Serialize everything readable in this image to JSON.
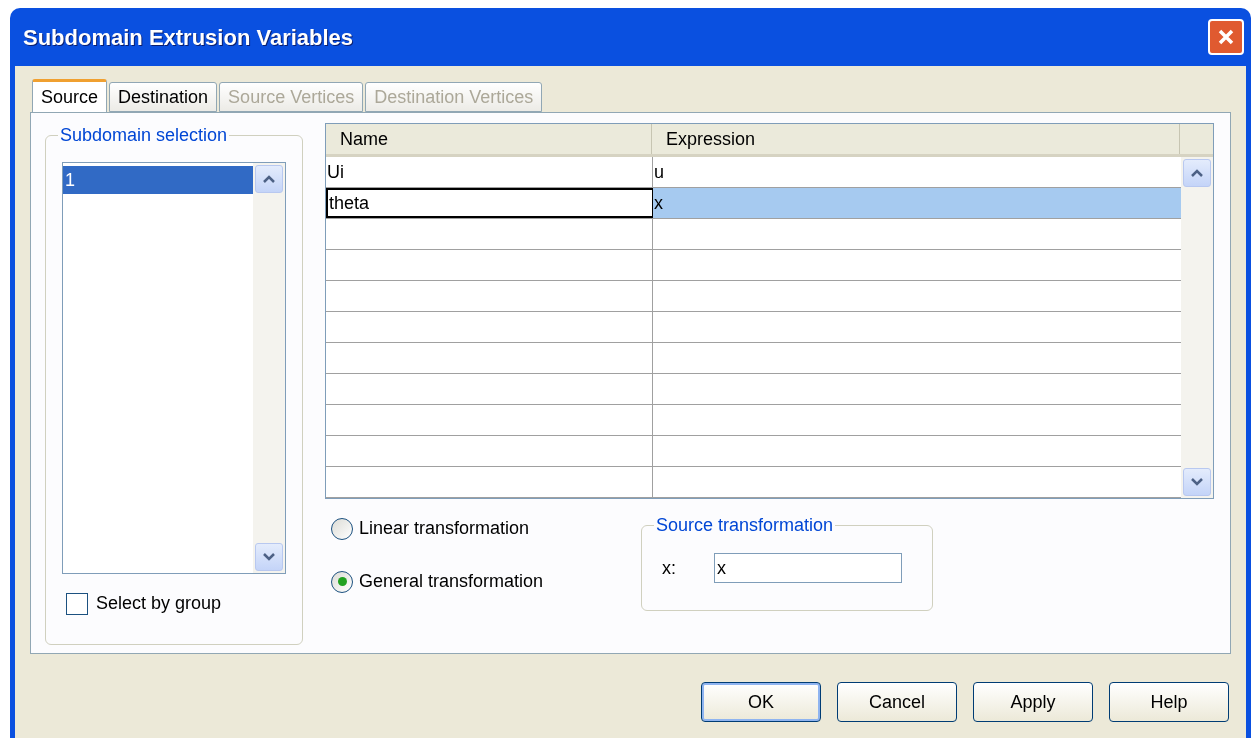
{
  "window": {
    "title": "Subdomain Extrusion Variables"
  },
  "tabs": [
    {
      "label": "Source",
      "selected": true,
      "disabled": false
    },
    {
      "label": "Destination",
      "selected": false,
      "disabled": false
    },
    {
      "label": "Source Vertices",
      "selected": false,
      "disabled": true
    },
    {
      "label": "Destination Vertices",
      "selected": false,
      "disabled": true
    }
  ],
  "subdomain_selection": {
    "title": "Subdomain selection",
    "items": [
      {
        "label": "1",
        "selected": true
      }
    ],
    "select_by_group": {
      "label": "Select by group",
      "checked": false
    }
  },
  "table": {
    "columns": [
      "Name",
      "Expression"
    ],
    "rows": [
      {
        "name": "Ui",
        "expression": "u",
        "selected": false,
        "editing": false
      },
      {
        "name": "theta",
        "expression": "x",
        "selected": true,
        "editing": true
      }
    ]
  },
  "transformation": [
    {
      "label": "Linear transformation",
      "selected": false
    },
    {
      "label": "General transformation",
      "selected": true
    }
  ],
  "source_transformation": {
    "title": "Source transformation",
    "label": "x:",
    "value": "x"
  },
  "buttons": [
    {
      "label": "OK",
      "default": true
    },
    {
      "label": "Cancel",
      "default": false
    },
    {
      "label": "Apply",
      "default": false
    },
    {
      "label": "Help",
      "default": false
    }
  ]
}
